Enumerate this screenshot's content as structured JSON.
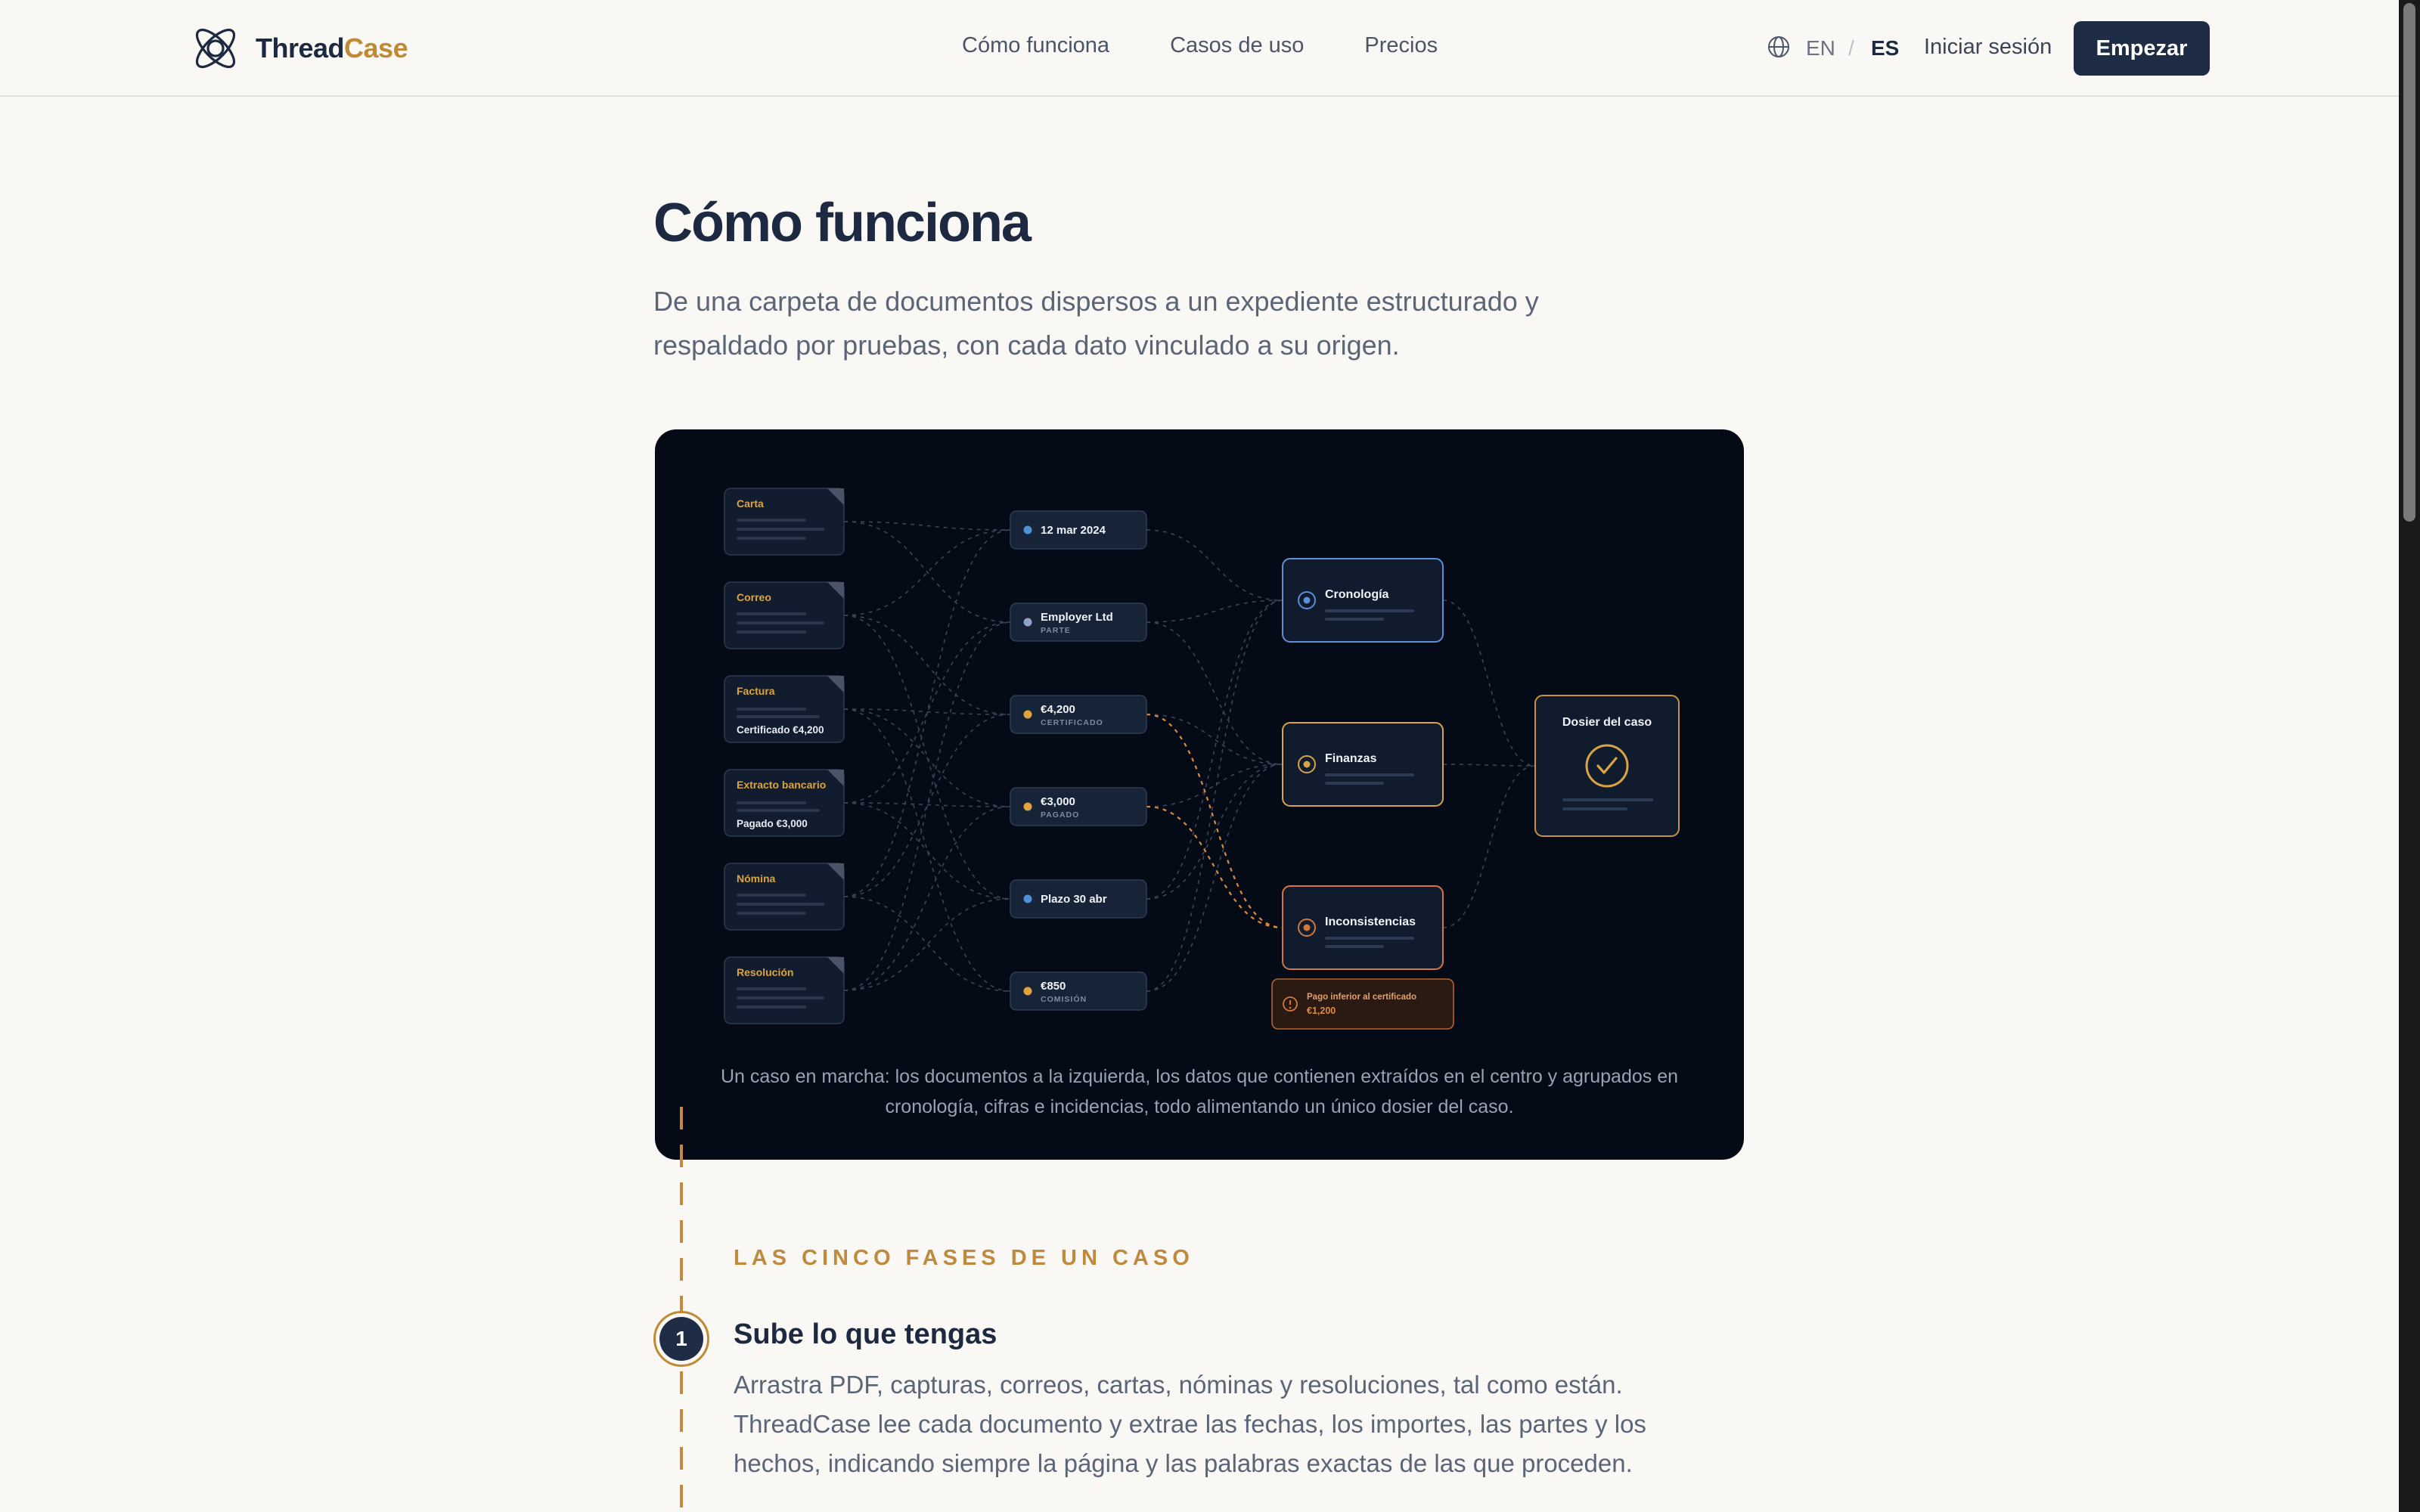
{
  "brand": {
    "name_a": "Thread",
    "name_b": "Case"
  },
  "nav": [
    "Cómo funciona",
    "Casos de uso",
    "Precios"
  ],
  "lang": {
    "en": "EN",
    "sep": "/",
    "es": "ES"
  },
  "login": "Iniciar sesión",
  "cta": "Empezar",
  "hero": {
    "title": "Cómo funciona",
    "lead": "De una carpeta de documentos dispersos a un expediente estructurado y respaldado por pruebas, con cada dato vinculado a su origen."
  },
  "diagram": {
    "documents": [
      {
        "name": "Carta",
        "note": ""
      },
      {
        "name": "Correo",
        "note": ""
      },
      {
        "name": "Factura",
        "note": "Certificado €4,200"
      },
      {
        "name": "Extracto bancario",
        "note": "Pagado €3,000"
      },
      {
        "name": "Nómina",
        "note": ""
      },
      {
        "name": "Resolución",
        "note": ""
      }
    ],
    "facts": [
      {
        "label": "12 mar 2024",
        "sub": "",
        "color": "#4f90d8"
      },
      {
        "label": "Employer Ltd",
        "sub": "PARTE",
        "color": "#8fa3c4"
      },
      {
        "label": "€4,200",
        "sub": "CERTIFICADO",
        "color": "#e0a33e"
      },
      {
        "label": "€3,000",
        "sub": "PAGADO",
        "color": "#e0a33e"
      },
      {
        "label": "Plazo 30 abr",
        "sub": "",
        "color": "#4f90d8"
      },
      {
        "label": "€850",
        "sub": "COMISIÓN",
        "color": "#e0a33e"
      }
    ],
    "groups": [
      {
        "label": "Cronología",
        "color": "#5b8fd6"
      },
      {
        "label": "Finanzas",
        "color": "#d9a441"
      },
      {
        "label": "Inconsistencias",
        "color": "#d4773a"
      }
    ],
    "alert": {
      "title": "Pago inferior al certificado",
      "value": "€1,200"
    },
    "dossier": "Dosier del caso",
    "caption": "Un caso en marcha: los documentos a la izquierda, los datos que contienen extraídos en el centro y agrupados en cronología, cifras e incidencias, todo alimentando un único dosier del caso."
  },
  "phases_label": "LAS CINCO FASES DE UN CASO",
  "step1": {
    "number": "1",
    "title": "Sube lo que tengas",
    "body": "Arrastra PDF, capturas, correos, cartas, nóminas y resoluciones, tal como están. ThreadCase lee cada documento y extrae las fechas, los importes, las partes y los hechos, indicando siempre la página y las palabras exactas de las que proceden."
  }
}
